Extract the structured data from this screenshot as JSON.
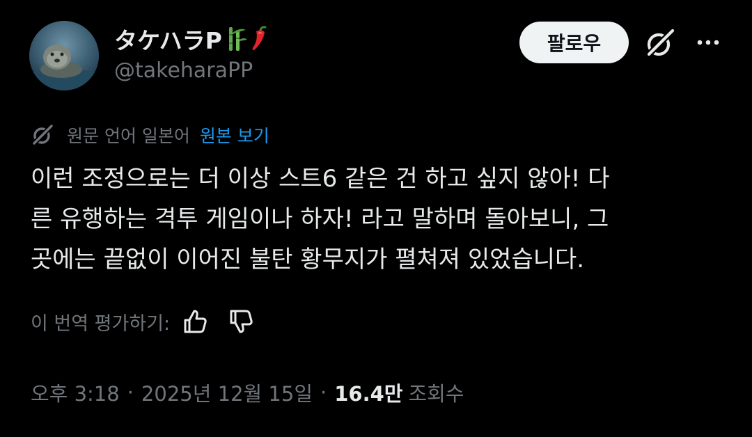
{
  "author": {
    "display_name": "タケハラP",
    "handle": "@takeharaPP"
  },
  "actions": {
    "follow_label": "팔로우"
  },
  "translation": {
    "note": "원문 언어 일본어",
    "view_original_label": "원본 보기"
  },
  "tweet": {
    "lines": [
      "이런 조정으로는 더 이상 스트6 같은 건 하고 싶지 않아! 다",
      "른 유행하는 격투 게임이나 하자! 라고 말하며 돌아보니, 그",
      "곳에는 끝없이 이어진 불탄 황무지가 펼쳐져 있었습니다."
    ]
  },
  "rating": {
    "label": "이 번역 평가하기:"
  },
  "meta": {
    "time": "오후 3:18",
    "separator": "·",
    "date": "2025년 12월 15일",
    "view_count": "16.4만",
    "views_label": "조회수"
  },
  "colors": {
    "background": "#000000",
    "text_primary": "#e7e9ea",
    "text_secondary": "#71767b",
    "link": "#1d9bf0",
    "follow_button_bg": "#eff3f4"
  },
  "icons": {
    "name_emoji_1": "bamboo-icon",
    "name_emoji_2": "chili-pepper-icon",
    "grok": "grok-icon",
    "more": "more-dots-icon",
    "translate": "grok-translate-icon",
    "thumbs_up": "thumbs-up-icon",
    "thumbs_down": "thumbs-down-icon"
  }
}
